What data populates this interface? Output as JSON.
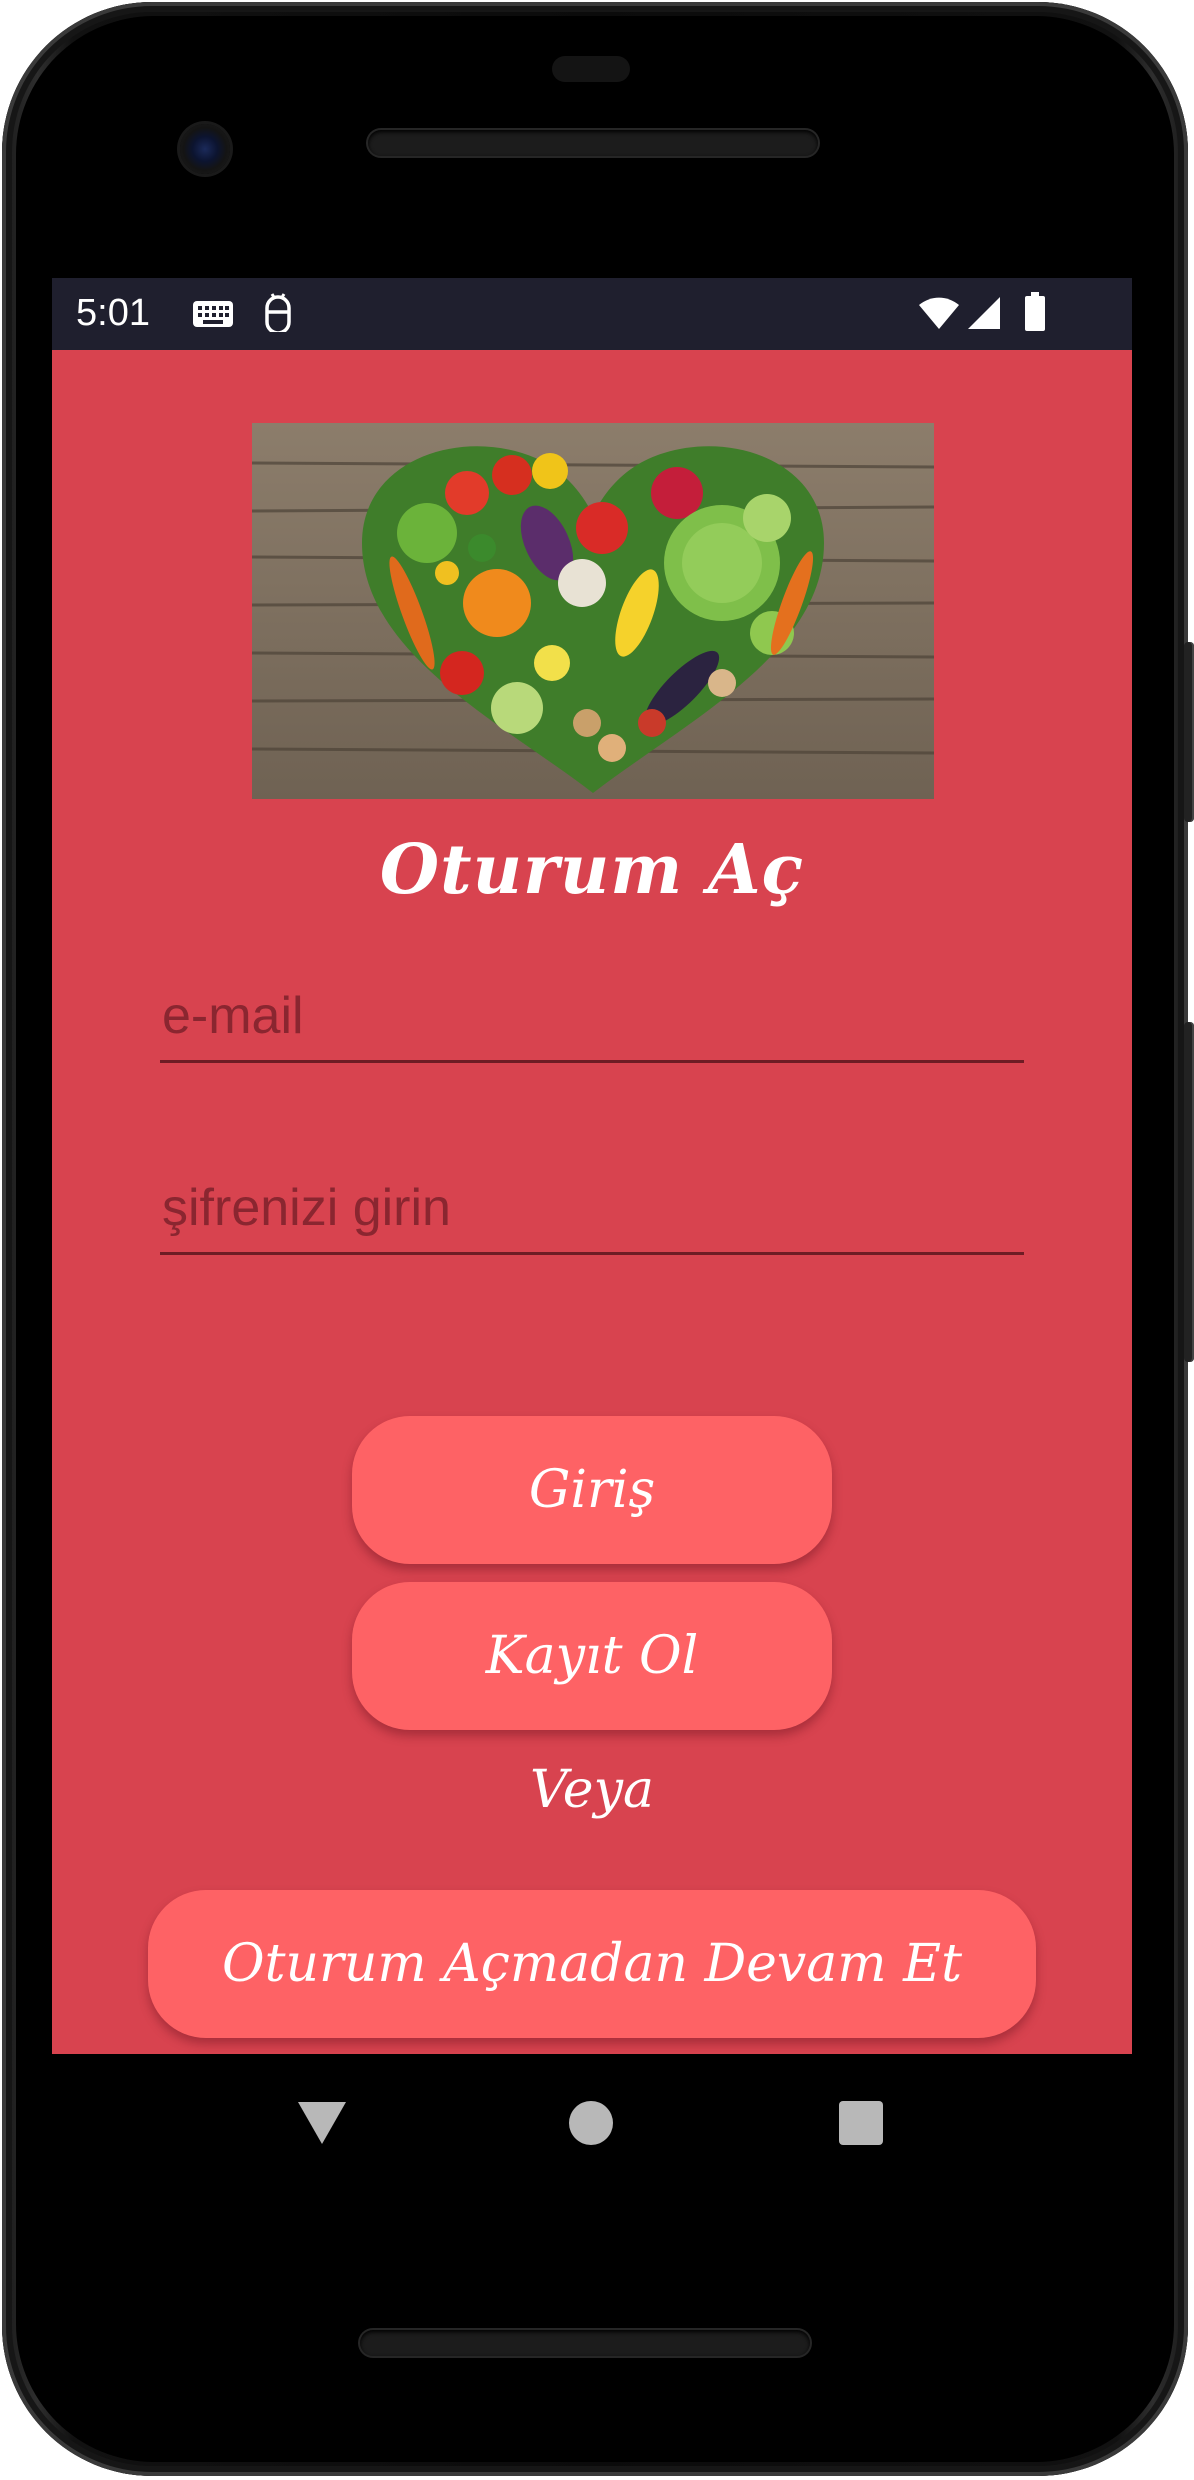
{
  "status_bar": {
    "time": "5:01",
    "icons": [
      "keyboard-icon",
      "android-debug-icon",
      "wifi-icon",
      "cell-signal-icon",
      "battery-icon"
    ]
  },
  "login": {
    "title": "Oturum Aç",
    "email_placeholder": "e-mail",
    "password_placeholder": "şifrenizi girin",
    "login_button": "Giriş",
    "register_button": "Kayıt Ol",
    "or_text": "Veya",
    "guest_button": "Oturum Açmadan Devam Et"
  },
  "nav_bar": {
    "back": "back-icon",
    "home": "home-icon",
    "recents": "recents-icon"
  },
  "colors": {
    "background": "#d8434f",
    "button": "#fe6265",
    "status_bar": "#1f1f2e",
    "text": "#ffffff"
  }
}
